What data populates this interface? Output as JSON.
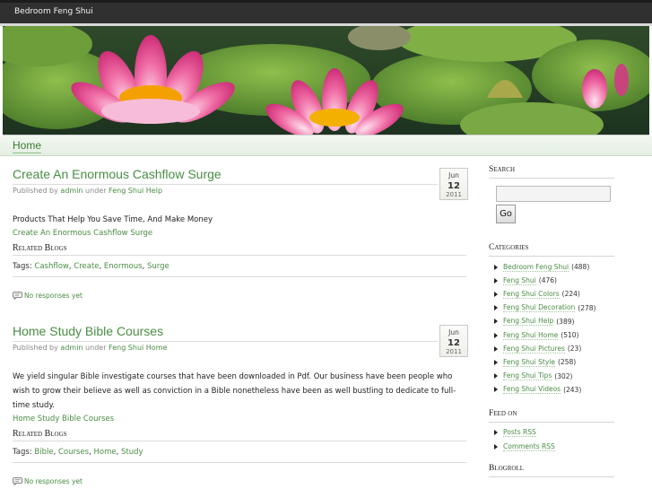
{
  "site": {
    "title": "Bedroom Feng Shui"
  },
  "nav": {
    "home_label": "Home"
  },
  "posts": [
    {
      "title": "Create An Enormous Cashflow Surge",
      "meta_prefix": "Published by",
      "author": "admin",
      "meta_under": "under",
      "category": "Feng Shui Help",
      "date": {
        "month": "Jun",
        "day": "12",
        "year": "2011"
      },
      "body": "Products That Help You Save Time, And Make Money",
      "link": "Create An Enormous Cashflow Surge",
      "related_label": "Related Blogs",
      "tags_label": "Tags:",
      "tags": [
        "Cashflow",
        "Create",
        "Enormous",
        "Surge"
      ],
      "responses": "No responses yet"
    },
    {
      "title": "Home Study Bible Courses",
      "meta_prefix": "Published by",
      "author": "admin",
      "meta_under": "under",
      "category": "Feng Shui Home",
      "date": {
        "month": "Jun",
        "day": "12",
        "year": "2011"
      },
      "body": "We yield singular Bible investigate courses that have been downloaded in Pdf. Our business have been people who wish to grow their believe as well as conviction in a Bible nonetheless have been as well bustling to dedicate to full-time study.",
      "link": "Home Study Bible Courses",
      "related_label": "Related Blogs",
      "tags_label": "Tags:",
      "tags": [
        "Bible",
        "Courses",
        "Home",
        "Study"
      ],
      "responses": "No responses yet"
    }
  ],
  "sidebar": {
    "search_heading": "Search",
    "search_value": "",
    "go_label": "Go",
    "categories_heading": "Categories",
    "categories": [
      {
        "name": "Bedroom Feng Shui",
        "count": "(488)"
      },
      {
        "name": "Feng Shui",
        "count": "(476)"
      },
      {
        "name": "Feng Shui Colors",
        "count": "(224)"
      },
      {
        "name": "Feng Shui Decoration",
        "count": "(278)"
      },
      {
        "name": "Feng Shui Help",
        "count": "(389)"
      },
      {
        "name": "Feng Shui Home",
        "count": "(510)"
      },
      {
        "name": "Feng Shui Pictures",
        "count": "(23)"
      },
      {
        "name": "Feng Shui Style",
        "count": "(258)"
      },
      {
        "name": "Feng Shui Tips",
        "count": "(302)"
      },
      {
        "name": "Feng Shui Videos",
        "count": "(243)"
      }
    ],
    "feed_heading": "Feed on",
    "feeds": [
      "Posts RSS",
      "Comments RSS"
    ],
    "blogroll_heading": "Blogroll"
  },
  "colors": {
    "accent": "#4a8d44",
    "topbar": "#303030",
    "nav_bg": "#e8f2e6"
  }
}
